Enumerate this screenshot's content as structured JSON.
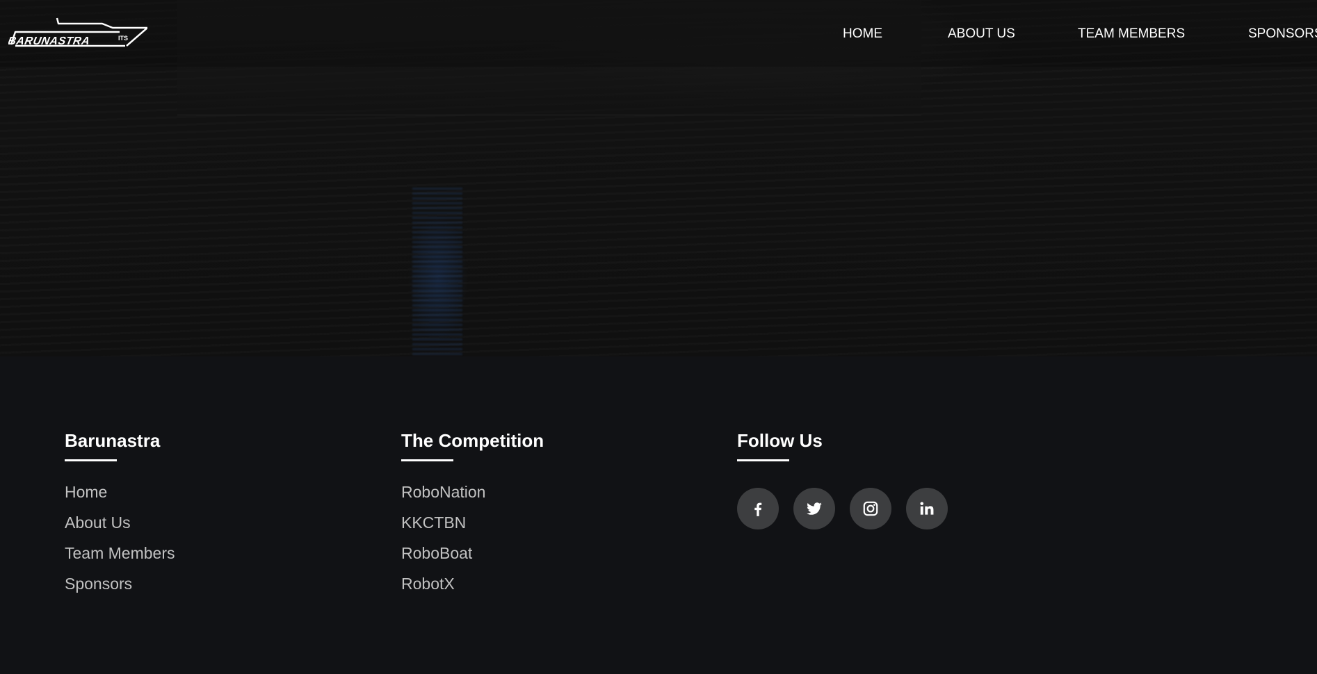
{
  "header": {
    "logo_text": "BARUNASTRA ITS",
    "nav": [
      {
        "label": "HOME"
      },
      {
        "label": "ABOUT US"
      },
      {
        "label": "TEAM MEMBERS"
      },
      {
        "label": "SPONSORS"
      }
    ]
  },
  "footer": {
    "barunastra": {
      "title": "Barunastra",
      "links": [
        "Home",
        "About Us",
        "Team Members",
        "Sponsors"
      ]
    },
    "competition": {
      "title": "The Competition",
      "links": [
        "RoboNation",
        "KKCTBN",
        "RoboBoat",
        "RobotX"
      ]
    },
    "follow": {
      "title": "Follow Us",
      "icons": [
        "facebook-icon",
        "twitter-icon",
        "instagram-icon",
        "linkedin-icon"
      ]
    }
  },
  "colors": {
    "footer_bg": "#111215",
    "social_btn_bg": "#3d3e40",
    "link_text": "#c2c2c2",
    "heading_text": "#ffffff"
  }
}
